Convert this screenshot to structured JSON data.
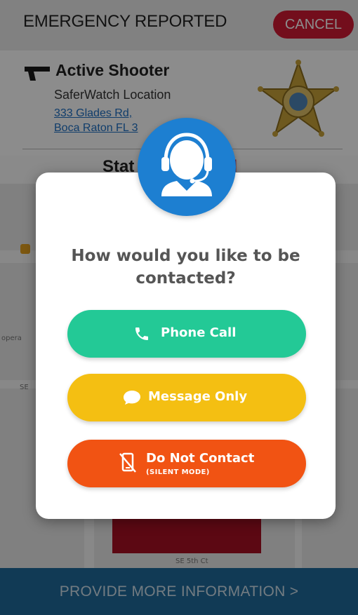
{
  "header": {
    "title": "EMERGENCY REPORTED",
    "cancel_label": "CANCEL"
  },
  "incident": {
    "type": "Active Shooter",
    "source": "SaferWatch Location",
    "address_line1": "333 Glades Rd,",
    "address_line2": "Boca Raton FL 3"
  },
  "status": {
    "label": "Stat",
    "value": "ed"
  },
  "footer": {
    "provide_label": "PROVIDE MORE INFORMATION >"
  },
  "modal": {
    "question": "How would you like to be contacted?",
    "options": [
      {
        "label": "Phone Call",
        "icon": "phone-icon"
      },
      {
        "label": "Message Only",
        "icon": "chat-bubble-icon"
      },
      {
        "label": "Do Not Contact",
        "sublabel": "(SILENT MODE)",
        "icon": "no-phone-icon"
      }
    ]
  },
  "map": {
    "labels": [
      "SE 5th Ct",
      "opera",
      "SE"
    ]
  },
  "colors": {
    "accent_red": "#d11a33",
    "agent_blue": "#1d7fd1",
    "phone_green": "#23c996",
    "message_yellow": "#f4bf12",
    "nocontact_orange": "#f15313",
    "footer_blue": "#1f6a9c"
  }
}
